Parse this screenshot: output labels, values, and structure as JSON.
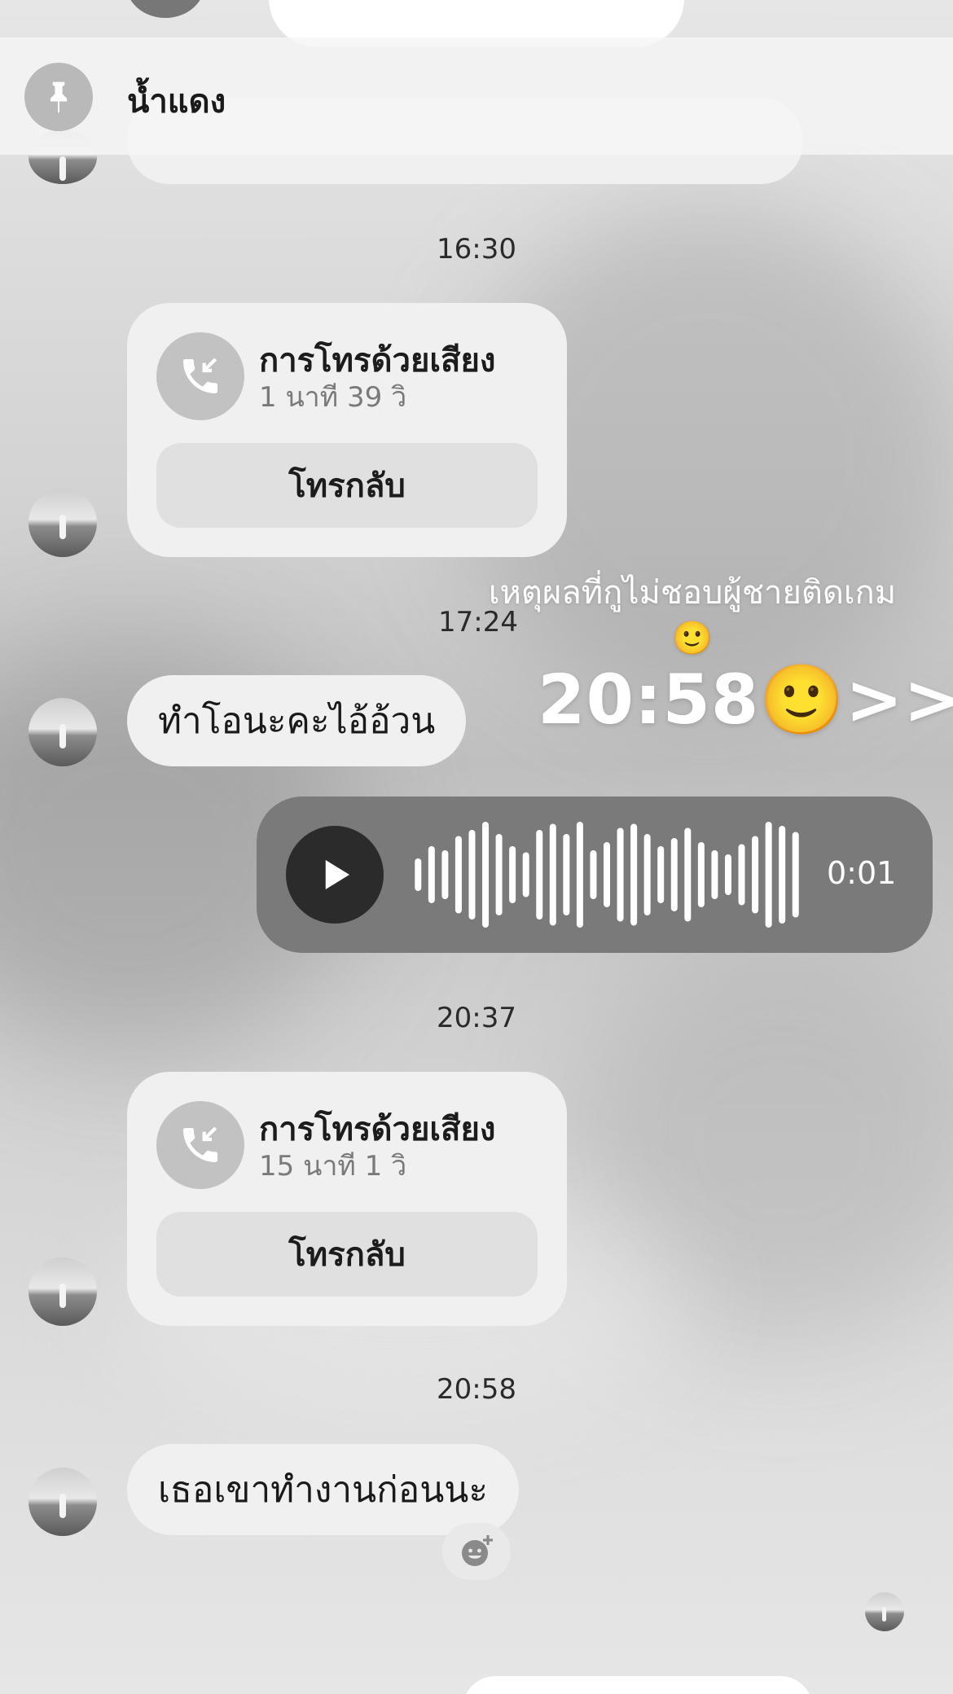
{
  "pinned": {
    "name": "น้ำแดง"
  },
  "timestamps": {
    "t1": "16:30",
    "t2": "17:24",
    "t3": "20:37",
    "t4": "20:58"
  },
  "calls": [
    {
      "title": "การโทรด้วยเสียง",
      "duration": "1 นาที 39 วิ",
      "callback_label": "โทรกลับ"
    },
    {
      "title": "การโทรด้วยเสียง",
      "duration": "15 นาที 1 วิ",
      "callback_label": "โทรกลับ"
    }
  ],
  "messages": {
    "m1": "ทำโอนะคะไอ้อ้วน",
    "m2": "เธอเขาทำงานก่อนนะ"
  },
  "overlay": {
    "caption": "เหตุผลที่กูไม่ชอบผู้ชายติดเกม🙂",
    "big": "20:58🙂>>"
  },
  "voice": {
    "duration": "0:01"
  },
  "icons": {
    "pin": "pin-icon",
    "call": "incoming-call-icon",
    "play": "play-icon",
    "reaction": "add-reaction-icon"
  }
}
